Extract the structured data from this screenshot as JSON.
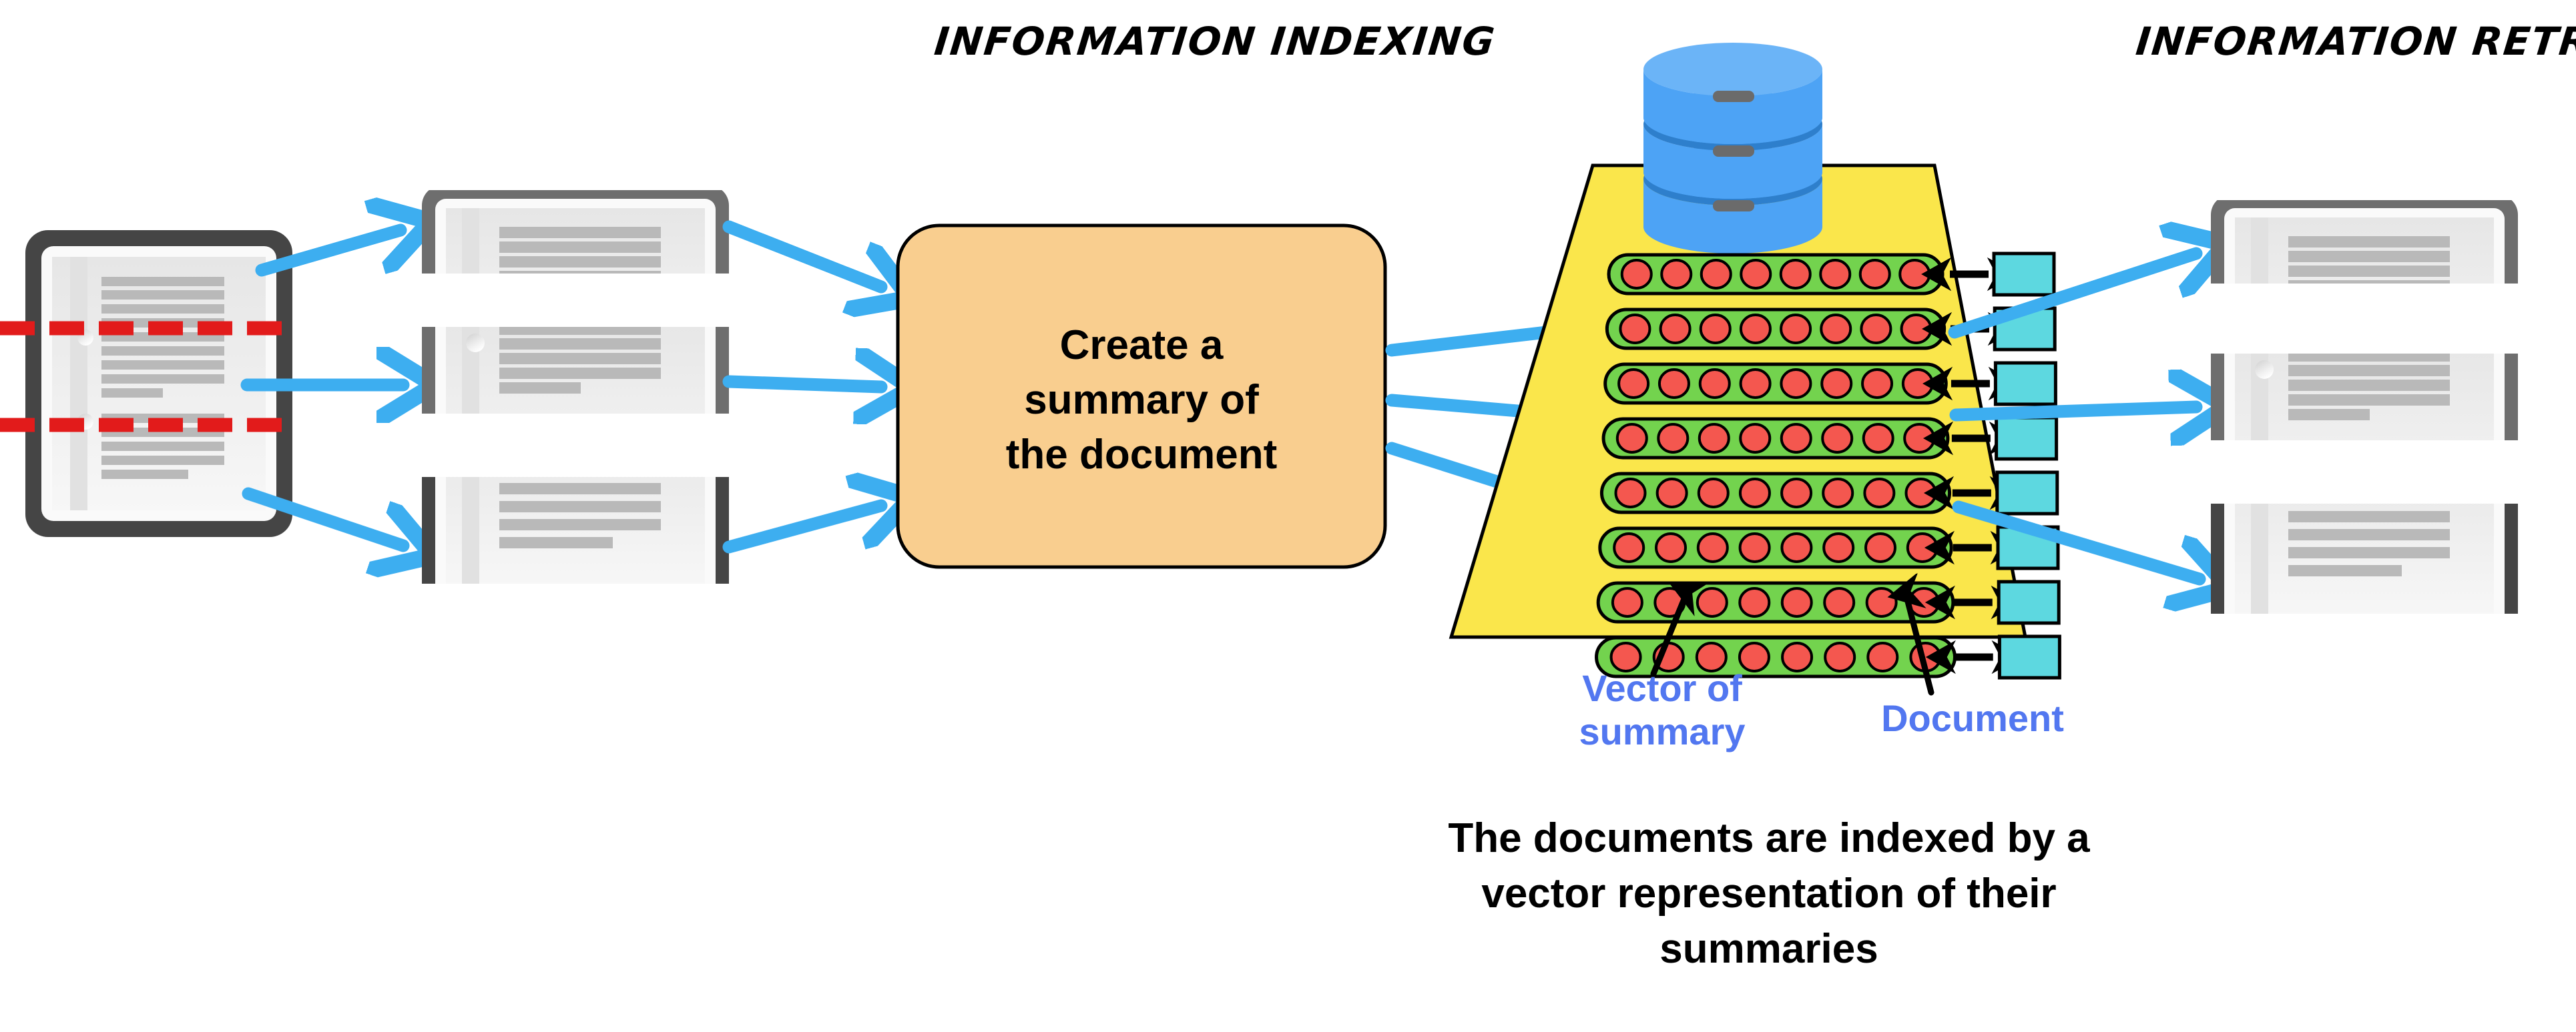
{
  "headings": {
    "indexing": "INFORMATION\nINDEXING",
    "retrieval": "INFORMATION\nRETRIEVAL"
  },
  "process_box": {
    "label": "Create a\nsummary of\nthe document",
    "fill_color": "#F9CE8F",
    "border_color": "#000000"
  },
  "labels": {
    "vector_of_summary": "Vector of\nsummary",
    "document": "Document",
    "label_color": "#5277F0"
  },
  "caption": "The documents are indexed by a\nvector representation of their\nsummaries",
  "vector_store": {
    "row_count": 8,
    "cells_per_vector": 8,
    "trapezoid_fill": "#FAE64B",
    "vector_pill_fill": "#73D34E",
    "vector_cell_fill": "#F4574F",
    "document_chip_fill": "#5DD8E0",
    "link_arrow_color": "#000000"
  },
  "database_icon": {
    "name": "database-cylinder",
    "disc_count": 3,
    "body_color": "#4DA3F5",
    "top_color": "#6BB4F7",
    "shadow_color": "#2E7FCC",
    "slot_color": "#6B6B6B"
  },
  "source_document": {
    "name": "source-document",
    "split_marker_color": "#E21B1B",
    "split_marker_count": 2,
    "border_color": "#454545",
    "page_color": "#EDEDED",
    "text_line_color": "#B9B9B9"
  },
  "chunk_documents": {
    "count": 3,
    "names": [
      "chunk-document-1",
      "chunk-document-2",
      "chunk-document-3"
    ]
  },
  "retrieved_documents": {
    "count": 3,
    "names": [
      "retrieved-document-1",
      "retrieved-document-2",
      "retrieved-document-3"
    ]
  },
  "arrows": {
    "flow_color": "#3DAEF0",
    "split_arrow_count": 3,
    "chunk_to_box_count": 3,
    "box_to_store_count": 3,
    "store_to_result_count": 3
  },
  "callouts": {
    "count": 2,
    "color": "#000000"
  }
}
